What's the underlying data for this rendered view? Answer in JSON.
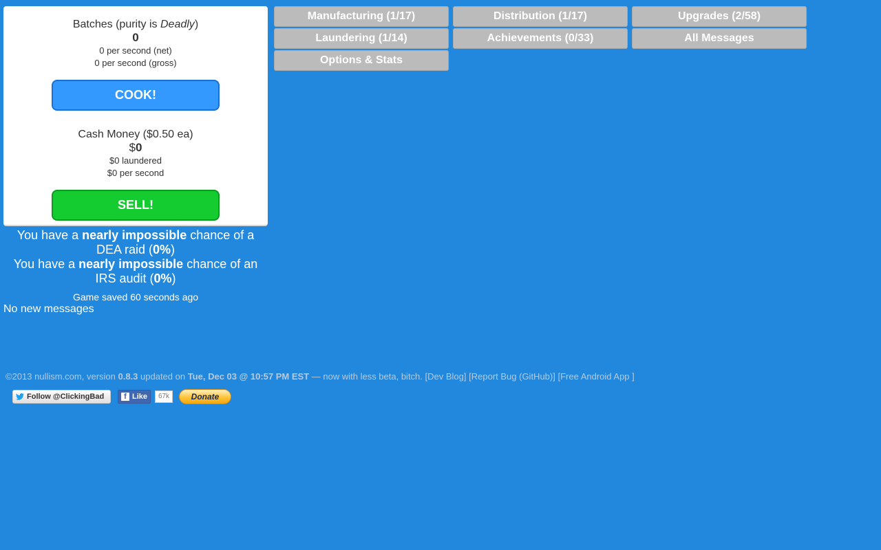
{
  "batches": {
    "title_prefix": "Batches (purity is ",
    "purity": "Deadly",
    "title_suffix": ")",
    "count": "0",
    "net_rate": "0 per second (net)",
    "gross_rate": "0 per second (gross)",
    "cook_label": "COOK!"
  },
  "cash": {
    "title": "Cash Money ($0.50 ea)",
    "currency": "$",
    "amount": "0",
    "laundered": "$0 laundered",
    "rate": "$0 per second",
    "sell_label": "SELL!"
  },
  "tabs": [
    {
      "label": "Manufacturing (1/17)"
    },
    {
      "label": "Distribution (1/17)"
    },
    {
      "label": "Upgrades (2/58)"
    },
    {
      "label": "Laundering (1/14)"
    },
    {
      "label": "Achievements (0/33)"
    },
    {
      "label": "All Messages"
    },
    {
      "label": "Options & Stats"
    }
  ],
  "risk": {
    "dea_prefix": "You have a ",
    "dea_level": "nearly impossible",
    "dea_mid": " chance of a DEA raid (",
    "dea_pct": "0%",
    "dea_end": ")",
    "irs_prefix": "You have a ",
    "irs_level": "nearly impossible",
    "irs_mid": " chance of an IRS audit (",
    "irs_pct": "0%",
    "irs_end": ")"
  },
  "save_status": "Game saved 60 seconds ago",
  "messages": "No new messages",
  "footer": {
    "copyright": "©2013 nullism.com, version ",
    "version": "0.8.3",
    "updated_on": " updated on ",
    "date": "Tue, Dec 03 @ 10:57 PM EST",
    "tagline": " — now with less beta, bitch. ",
    "link_dev_blog": "[Dev Blog]",
    "link_report_bug": "[Report Bug (GitHub)]",
    "link_android": "[Free Android App ]"
  },
  "social": {
    "twitter_label": "Follow @ClickingBad",
    "fb_label": "Like",
    "fb_count": "67k",
    "donate_label": "Donate"
  }
}
